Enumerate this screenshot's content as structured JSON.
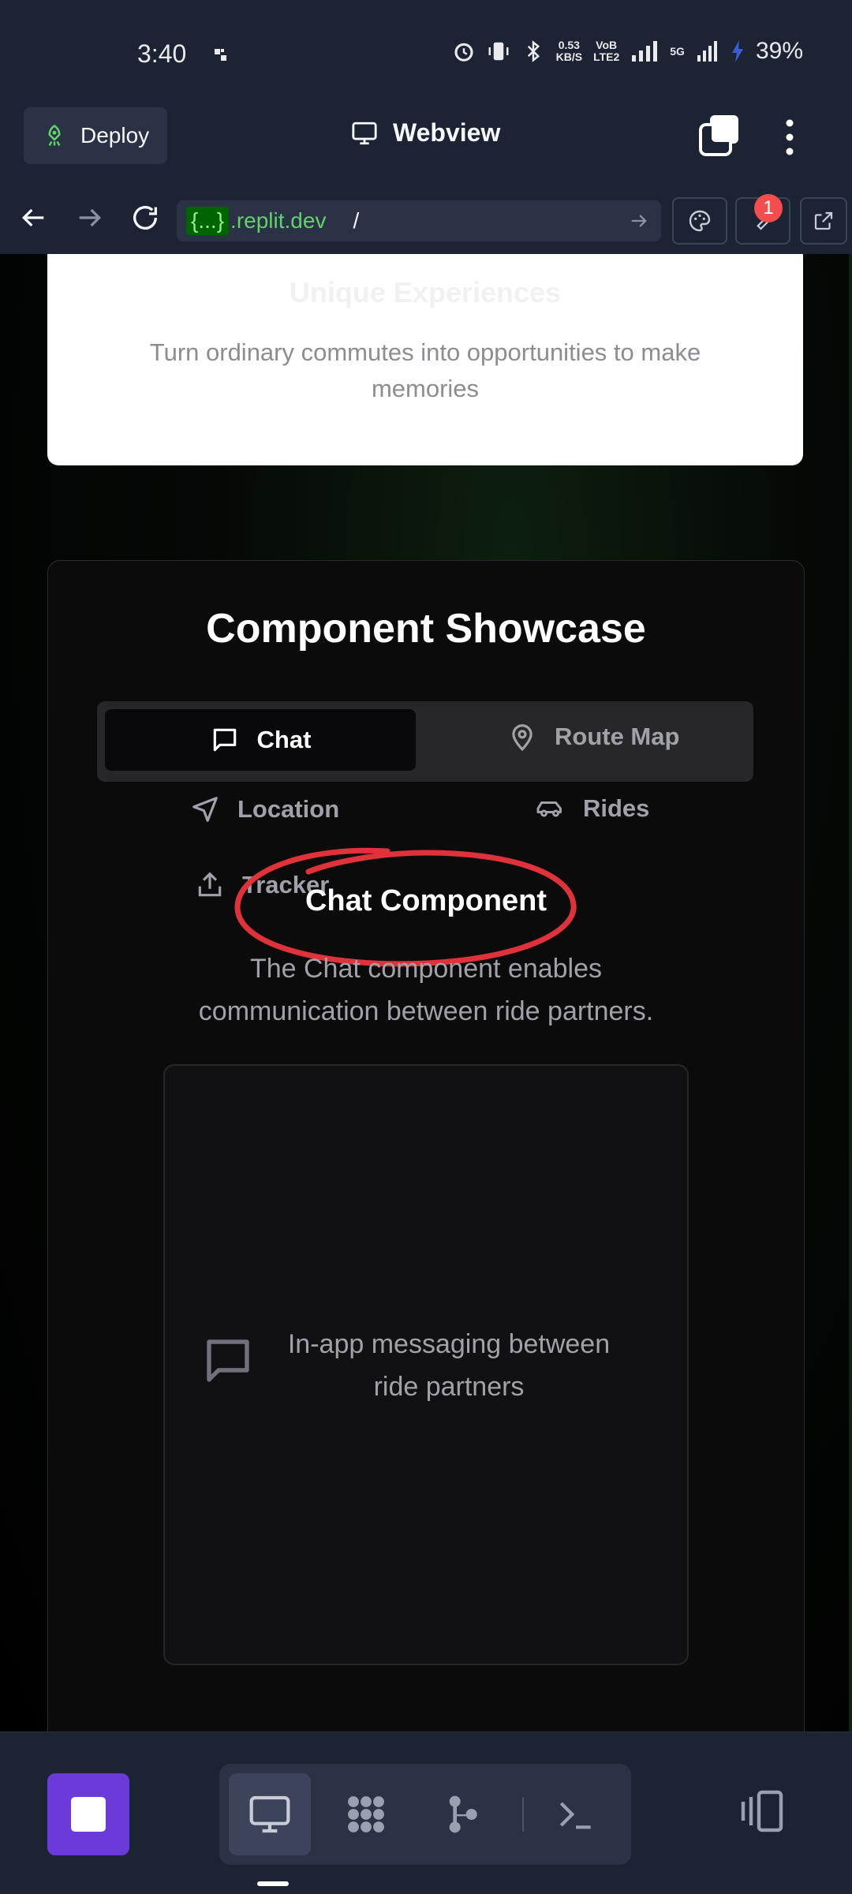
{
  "status_bar": {
    "time": "3:40",
    "net_speed_value": "0.53",
    "net_speed_unit": "KB/S",
    "volte_top": "VoB",
    "volte_bottom": "LTE2",
    "network_label": "5G",
    "battery": "39%"
  },
  "header": {
    "deploy_label": "Deploy",
    "title": "Webview"
  },
  "urlbar": {
    "brace": "{...}",
    "host": ".replit.dev",
    "path": "/",
    "tools_badge": "1"
  },
  "page": {
    "feature_card": {
      "title": "Unique Experiences",
      "description": "Turn ordinary commutes into opportunities to make memories"
    },
    "showcase": {
      "title": "Component Showcase",
      "tabs": [
        {
          "label": "Chat",
          "icon": "message-square-icon",
          "active": true
        },
        {
          "label": "Route Map",
          "icon": "map-pin-icon",
          "active": false
        },
        {
          "label": "Location",
          "icon": "navigation-icon",
          "active": false
        },
        {
          "label": "Rides",
          "icon": "car-icon",
          "active": false
        },
        {
          "label": "Tracker",
          "icon": "share-icon",
          "active": false
        }
      ],
      "heading": "Chat Component",
      "description": "The Chat component enables communication between ride partners.",
      "preview_text": "In-app messaging between ride partners",
      "annotation_color": "#e0323a"
    }
  },
  "colors": {
    "accent_purple": "#6c3ad9",
    "replit_bg": "#1c2333",
    "url_green": "#5fd36a",
    "badge_red": "#f44d4d"
  }
}
